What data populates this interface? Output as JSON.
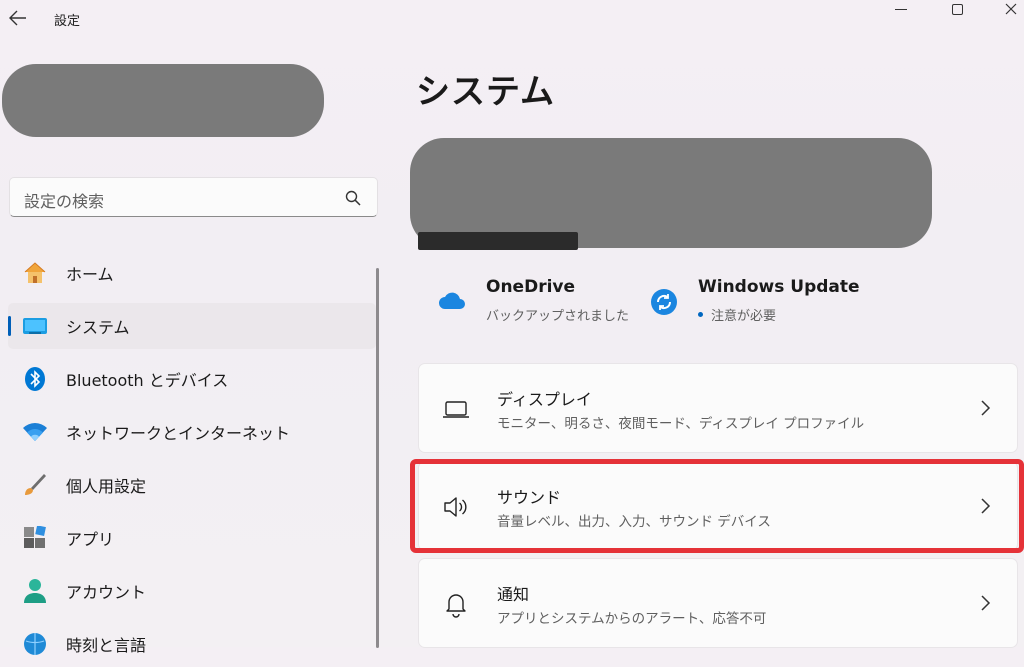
{
  "titlebar": {
    "back_icon": "arrow-left-icon",
    "title": "設定"
  },
  "search": {
    "placeholder": "設定の検索"
  },
  "sidebar": {
    "items": [
      {
        "label": "ホーム",
        "icon": "home-icon"
      },
      {
        "label": "システム",
        "icon": "system-icon",
        "selected": true
      },
      {
        "label": "Bluetooth とデバイス",
        "icon": "bluetooth-icon"
      },
      {
        "label": "ネットワークとインターネット",
        "icon": "wifi-icon"
      },
      {
        "label": "個人用設定",
        "icon": "brush-icon"
      },
      {
        "label": "アプリ",
        "icon": "apps-icon"
      },
      {
        "label": "アカウント",
        "icon": "account-icon"
      },
      {
        "label": "時刻と言語",
        "icon": "globe-icon"
      }
    ]
  },
  "main": {
    "title": "システム",
    "quick": [
      {
        "title": "OneDrive",
        "subtitle": "バックアップされました",
        "icon": "onedrive-icon"
      },
      {
        "title": "Windows Update",
        "subtitle": "注意が必要",
        "icon": "windows-update-icon"
      }
    ],
    "cards": [
      {
        "title": "ディスプレイ",
        "subtitle": "モニター、明るさ、夜間モード、ディスプレイ プロファイル",
        "icon": "laptop-icon"
      },
      {
        "title": "サウンド",
        "subtitle": "音量レベル、出力、入力、サウンド デバイス",
        "icon": "speaker-icon",
        "highlighted": true
      },
      {
        "title": "通知",
        "subtitle": "アプリとシステムからのアラート、応答不可",
        "icon": "bell-icon"
      }
    ]
  },
  "colors": {
    "accent": "#005fb8",
    "highlight": "#e53238",
    "update_dot": "#0067c0"
  }
}
